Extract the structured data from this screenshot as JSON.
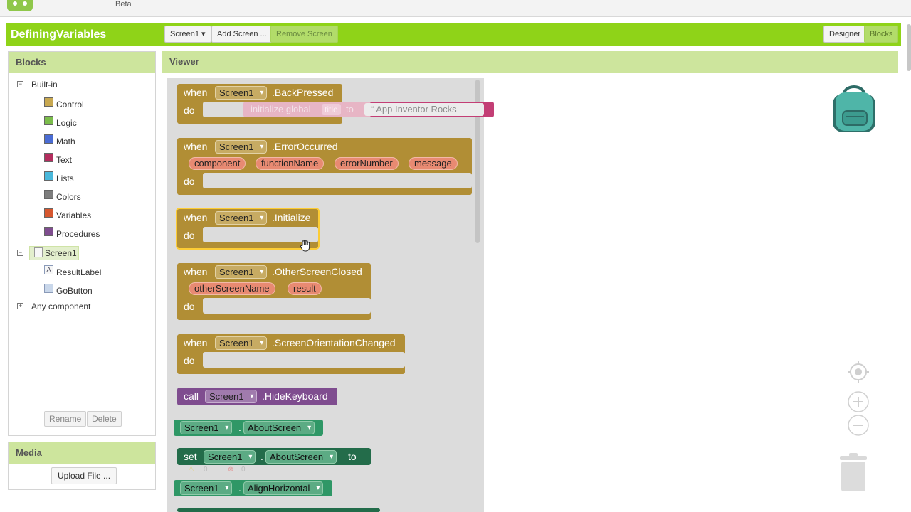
{
  "topbar": {
    "beta_label": "Beta"
  },
  "project": {
    "name": "DefiningVariables",
    "screen_select": "Screen1 ▾",
    "add_screen": "Add Screen ...",
    "remove_screen": "Remove Screen",
    "designer": "Designer",
    "blocks": "Blocks"
  },
  "blocks_panel": {
    "title": "Blocks",
    "builtin": "Built-in",
    "categories": [
      {
        "label": "Control",
        "color": "#c8a850"
      },
      {
        "label": "Logic",
        "color": "#7bbd4b"
      },
      {
        "label": "Math",
        "color": "#4a6cd4"
      },
      {
        "label": "Text",
        "color": "#b32d5e"
      },
      {
        "label": "Lists",
        "color": "#49b8db"
      },
      {
        "label": "Colors",
        "color": "#7d7d7d"
      },
      {
        "label": "Variables",
        "color": "#d6572f"
      },
      {
        "label": "Procedures",
        "color": "#7f4d8f"
      }
    ],
    "screen": "Screen1",
    "components": [
      "ResultLabel",
      "GoButton"
    ],
    "any_component": "Any component",
    "rename": "Rename",
    "delete": "Delete"
  },
  "media": {
    "title": "Media",
    "upload": "Upload File ..."
  },
  "viewer": {
    "title": "Viewer"
  },
  "flyout": {
    "when": "when",
    "do": "do",
    "component": "Screen1",
    "events": {
      "back_pressed": ".BackPressed",
      "error_occurred": ".ErrorOccurred",
      "error_params": [
        "component",
        "functionName",
        "errorNumber",
        "message"
      ],
      "initialize": ".Initialize",
      "other_screen_closed": ".OtherScreenClosed",
      "other_params": [
        "otherScreenName",
        "result"
      ],
      "orientation_changed": ".ScreenOrientationChanged"
    },
    "call": "call",
    "hide_keyboard": ".HideKeyboard",
    "dot": ".",
    "about_screen": "AboutScreen",
    "set": "set",
    "to": "to",
    "align_horizontal": "AlignHorizontal"
  },
  "ghost_block": {
    "initialize_global": "initialize global",
    "name": "title",
    "to": "to",
    "value": "App Inventor Rocks"
  },
  "warnings": {
    "warn": "0",
    "error": "0"
  }
}
